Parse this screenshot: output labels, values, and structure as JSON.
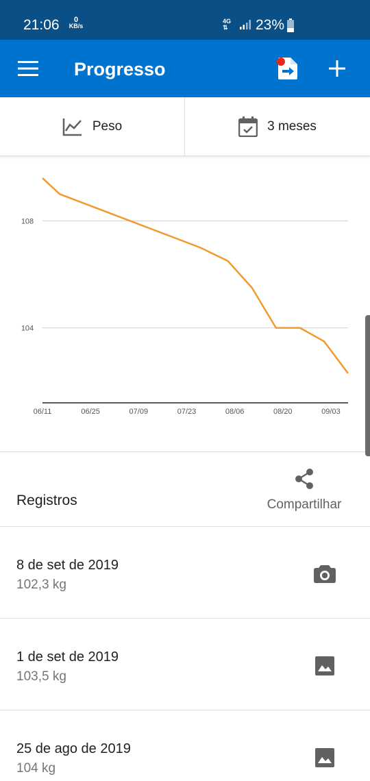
{
  "status_bar": {
    "time": "21:06",
    "data_rate_value": "0",
    "data_rate_unit": "KB/s",
    "network": "4G",
    "battery": "23%"
  },
  "app_bar": {
    "title": "Progresso",
    "menu_icon": "hamburger-menu-icon",
    "export_icon": "file-export-icon",
    "add_icon": "plus-icon",
    "colors": {
      "bar": "#0073cf",
      "status": "#0a4f86",
      "notify": "#e5271c"
    }
  },
  "filters": {
    "metric_label": "Peso",
    "metric_icon": "line-chart-icon",
    "range_label": "3 meses",
    "range_icon": "calendar-check-icon"
  },
  "chart_data": {
    "type": "line",
    "title": "",
    "xlabel": "",
    "ylabel": "",
    "x_tick_labels": [
      "06/11",
      "06/25",
      "07/09",
      "07/23",
      "08/06",
      "08/20",
      "09/03"
    ],
    "y_tick_labels": [
      "108",
      "104"
    ],
    "y_ticks": [
      108,
      104
    ],
    "xlim": [
      "2019-06-11",
      "2019-09-08"
    ],
    "ylim": [
      101.2,
      109.7
    ],
    "grid": true,
    "series": [
      {
        "color": "#f29a2e",
        "x": [
          "2019-06-11",
          "2019-06-16",
          "2019-07-27",
          "2019-08-04",
          "2019-08-11",
          "2019-08-18",
          "2019-08-25",
          "2019-09-01",
          "2019-09-08"
        ],
        "y": [
          109.6,
          109.0,
          107.0,
          106.5,
          105.5,
          104.0,
          104.0,
          103.5,
          102.3
        ]
      }
    ]
  },
  "records": {
    "title": "Registros",
    "share_label": "Compartilhar",
    "share_icon": "share-icon",
    "items": [
      {
        "date": "8 de set de 2019",
        "weight": "102,3 kg",
        "icon": "camera-icon"
      },
      {
        "date": "1 de set de 2019",
        "weight": "103,5 kg",
        "icon": "image-icon"
      },
      {
        "date": "25 de ago de 2019",
        "weight": "104 kg",
        "icon": "image-icon"
      }
    ]
  }
}
